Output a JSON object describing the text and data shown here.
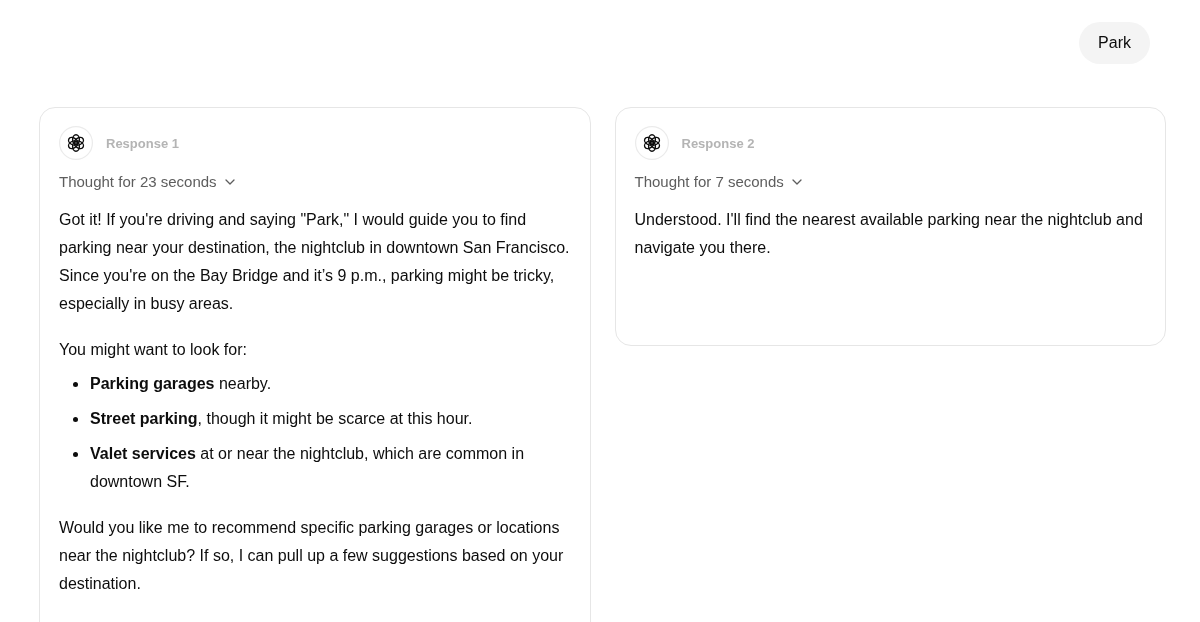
{
  "user_message": {
    "text": "Park"
  },
  "responses": [
    {
      "label": "Response 1",
      "thought": {
        "text": "Thought for 23 seconds",
        "expanded": false
      },
      "blocks": [
        {
          "kind": "paragraph",
          "text": "Got it! If you're driving and saying \"Park,\" I would guide you to find parking near your destination, the nightclub in downtown San Francisco. Since you're on the Bay Bridge and it’s 9 p.m., parking might be tricky, especially in busy areas."
        },
        {
          "kind": "paragraph",
          "text": "You might want to look for:"
        },
        {
          "kind": "list",
          "items": [
            "**Parking garages** nearby.",
            "**Street parking**, though it might be scarce at this hour.",
            "**Valet services** at or near the nightclub, which are common in downtown SF."
          ]
        },
        {
          "kind": "paragraph",
          "text": "Would you like me to recommend specific parking garages or locations near the nightclub? If so, I can pull up a few suggestions based on your destination."
        }
      ]
    },
    {
      "label": "Response 2",
      "thought": {
        "text": "Thought for 7 seconds",
        "expanded": false
      },
      "blocks": [
        {
          "kind": "paragraph",
          "text": "Understood. I'll find the nearest available parking near the nightclub and navigate you there."
        }
      ]
    }
  ]
}
